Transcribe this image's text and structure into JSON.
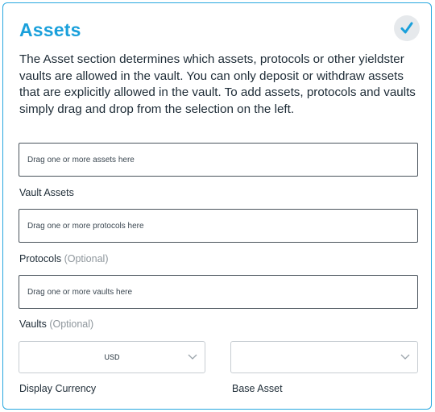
{
  "section": {
    "title": "Assets",
    "description": "The Asset section determines which assets, protocols or other yieldster vaults are allowed in the vault. You can only deposit or withdraw assets that are explicitly allowed in the vault. To add assets, protocols and vaults simply drag and drop from the selection on the left.",
    "status_icon": "checkmark-icon"
  },
  "vault_assets": {
    "placeholder": "Drag one or more assets here",
    "label": "Vault Assets"
  },
  "protocols": {
    "placeholder": "Drag one or more protocols here",
    "label": "Protocols",
    "optional": "(Optional)"
  },
  "vaults": {
    "placeholder": "Drag one or more vaults here",
    "label": "Vaults",
    "optional": "(Optional)"
  },
  "display_currency": {
    "value": "USD",
    "label": "Display Currency"
  },
  "base_asset": {
    "value": "",
    "label": "Base Asset"
  },
  "colors": {
    "accent": "#1aa0db",
    "border": "#29a8e0",
    "muted": "#8e969c"
  }
}
